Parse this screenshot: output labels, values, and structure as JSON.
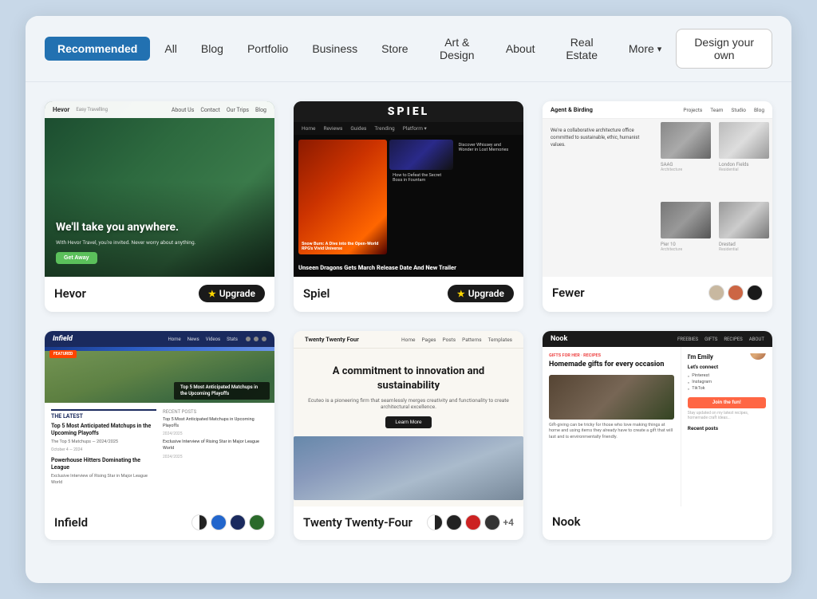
{
  "nav": {
    "tabs": [
      {
        "label": "Recommended",
        "active": true
      },
      {
        "label": "All",
        "active": false
      },
      {
        "label": "Blog",
        "active": false
      },
      {
        "label": "Portfolio",
        "active": false
      },
      {
        "label": "Business",
        "active": false
      },
      {
        "label": "Store",
        "active": false
      },
      {
        "label": "Art & Design",
        "active": false
      },
      {
        "label": "About",
        "active": false
      },
      {
        "label": "Real Estate",
        "active": false
      },
      {
        "label": "More",
        "active": false,
        "dropdown": true
      }
    ],
    "design_own_label": "Design your own"
  },
  "themes": [
    {
      "id": "hevor",
      "name": "Hevor",
      "badge": "Upgrade",
      "badge_type": "upgrade",
      "preview": {
        "logo": "Hevor",
        "nav_links": [
          "About Us",
          "Contact",
          "Our Trips",
          "Blog"
        ],
        "hero_text": "We'll take you anywhere.",
        "hero_sub": "With Hevor Travel, you're invited. Never worry about anything.",
        "cta": "Get Away"
      }
    },
    {
      "id": "spiel",
      "name": "Spiel",
      "badge": "Upgrade",
      "badge_type": "upgrade",
      "preview": {
        "logo": "SPIEL",
        "headline": "Unseen Dragons Gets March Release Date And New Trailer",
        "caption": "How to Defeat the Secret Boss in Fountam"
      }
    },
    {
      "id": "fewer",
      "name": "Fewer",
      "badge_type": "swatches",
      "swatches": [
        "#c8b8a0",
        "#cc6644",
        "#1a1a1a"
      ],
      "preview": {
        "description": "We're a collaborative architecture office committed to sustainable, ethic, humanist values.",
        "nav_links": [
          "Projects",
          "Team",
          "Studio",
          "Blog"
        ],
        "sections": [
          "SAAG",
          "London Fields",
          "Pier 10",
          "Drestad"
        ]
      }
    },
    {
      "id": "infield",
      "name": "Infield",
      "badge_type": "swatches",
      "swatches": [
        "half-dark",
        "blue",
        "dark-blue",
        "green"
      ],
      "preview": {
        "logo": "Infield",
        "featured_label": "FEATURED",
        "article1": "Top 5 Most Anticipated Matchups in the Upcoming Playoffs",
        "article2": "Powerhouse Hitters Dominating the League"
      }
    },
    {
      "id": "twentytwentyfour",
      "name": "Twenty Twenty-Four",
      "badge_type": "swatches",
      "swatches": [
        "half-dark",
        "dark",
        "red",
        "dark2"
      ],
      "swatch_plus": "+4",
      "preview": {
        "headline": "A commitment to innovation and sustainability",
        "description": "Ecuteo is a pioneering firm that seamlessly merges creativity and functionality to create architectural excellence.",
        "cta": "Learn More"
      }
    },
    {
      "id": "nook",
      "name": "Nook",
      "badge_type": "none",
      "preview": {
        "logo": "Nook",
        "label": "GIFTS FOR HER RECIPES",
        "headline": "Homemade gifts for every occasion",
        "sidebar_name": "I'm Emily",
        "connect": "Let's connect",
        "social": [
          "Pinterest",
          "Instagram",
          "TikTok"
        ],
        "join_btn": "Join the fun!"
      }
    }
  ]
}
